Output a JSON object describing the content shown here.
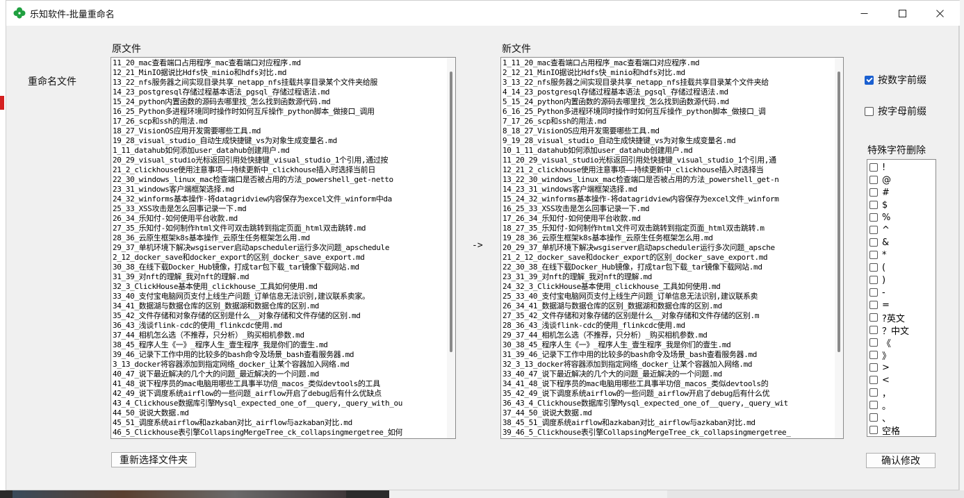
{
  "window": {
    "title": "乐知软件-批量重命名"
  },
  "rename_label": "重命名文件",
  "original": {
    "label": "原文件",
    "files": [
      "11_20_mac查看端口占用程序_mac查看端口对应程序.md",
      "12_21_MinIO据说比Hdfs快_minio和hdfs对比.md",
      "13_22_nfs服务器之间实现目录共享_netapp_nfs挂载共享目录某个文件夹给服",
      "14_23_postgresql存储过程基本语法_pgsql_存储过程语法.md",
      "15_24_python内置函数的源码去哪里找_怎么找到函数源代码.md",
      "16_25_Python多进程环境同时操作时如何互斥操作_python脚本_做接口_调用",
      "17_26_scp和ssh的用法.md",
      "18_27_VisionOS应用开发需要哪些工具.md",
      "19_28_visual_studio_自动生成快捷键_vs为对象生成变量名.md",
      "1_11_datahub如何添加user_datahub创建用户.md",
      "20_29_visual_studio光标返回引用处快捷键_visual_studio_1个引用,通过按",
      "21_2_clickhouse使用注意事项——持续更新中_clickhouse插入时选择当前日",
      "22_30_windows_linux_mac检查端口是否被占用的方法_powershell_get-netto",
      "23_31_windows客户端框架选择.md",
      "24_32_winforms基本操作-将datagridview内容保存为excel文件_winform中da",
      "25_33_XSS攻击是怎么回事记录一下.md",
      "26_34_乐知付-如何使用平台收款.md",
      "27_35_乐知付-如何制作html文件可双击跳转到指定页面_html双击跳转.md",
      "28_36_云原生框架k8s基本操作_云原生任务框架怎么用.md",
      "29_37_单机环境下解决wsgiserver启动apscheduler运行多次问题_apschedule",
      "2_12_docker_save和docker_export的区别_docker_save_export.md",
      "30_38_在线下载Docker_Hub镜像，打成tar包下载_tar镜像下载网站.md",
      "31_39_对nft的理解_我对nft的理解.md",
      "32_3_ClickHouse基本使用_clickhouse_工具如何使用.md",
      "33_40_支付宝电脑网页支付上线生产问题_订单信息无法识别,建议联系卖家。",
      "34_41_数据湖与数据仓库的区别_数据湖和数据仓库的区别.md",
      "35_42_文件存储和对象存储的区别是什么__对象存储和文件存储的区别.md",
      "36_43_浅谈flink-cdc的使用_flinkcdc使用.md",
      "37_44_相机怎么选（不推荐，只分析）_购买相机参数.md",
      "38_45_程序人生《一》_程序人生_壹生程序_我是你们的壹生.md",
      "39_46_记录下工作中用的比较多的bash命令及场景_bash查看服务器.md",
      "3_13_docker将容器添加到指定网络_docker_让某个容器加入网络.md",
      "40_47_说下最近解决的几个大的问题_最近解决的一个问题.md",
      "41_48_说下程序员的mac电脑用哪些工具事半功倍_macos_类似devtools的工具",
      "42_49_说下调度系统airflow的一些问题_airflow开启了debug后有什么优缺点",
      "43_4_Clickhouse数据库引擎Mysql_expected_one_of__query,_query_with_ou",
      "44_50_说说大数据.md",
      "45_51_调度系统airflow和azkaban对比_airflow与azkaban对比.md",
      "46_5_Clickhouse表引擎CollapsingMergeTree_ck_collapsingmergetree_如何"
    ]
  },
  "arrow": "->",
  "new": {
    "label": "新文件",
    "files": [
      "1_11_20_mac查看端口占用程序_mac查看端口对应程序.md",
      "2_12_21_MinIO据说比Hdfs快_minio和hdfs对比.md",
      "3_13_22_nfs服务器之间实现目录共享_netapp_nfs挂载共享目录某个文件夹给",
      "4_14_23_postgresql存储过程基本语法_pgsql_存储过程语法.md",
      "5_15_24_python内置函数的源码去哪里找_怎么找到函数源代码.md",
      "6_16_25_Python多进程环境同时操作时如何互斥操作_python脚本_做接口_调",
      "7_17_26_scp和ssh的用法.md",
      "8_18_27_VisionOS应用开发需要哪些工具.md",
      "9_19_28_visual_studio_自动生成快捷键_vs为对象生成变量名.md",
      "10_1_11_datahub如何添加user_datahub创建用户.md",
      "11_20_29_visual_studio光标返回引用处快捷键_visual_studio_1个引用,通",
      "12_21_2_clickhouse使用注意事项——持续更新中_clickhouse插入时选择当",
      "13_22_30_windows_linux_mac检查端口是否被占用的方法_powershell_get-n",
      "14_23_31_windows客户端框架选择.md",
      "15_24_32_winforms基本操作-将datagridview内容保存为excel文件_winform",
      "16_25_33_XSS攻击是怎么回事记录一下.md",
      "17_26_34_乐知付-如何使用平台收款.md",
      "18_27_35_乐知付-如何制作html文件可双击跳转到指定页面_html双击跳转.m",
      "19_28_36_云原生框架k8s基本操作_云原生任务框架怎么用.md",
      "20_29_37_单机环境下解决wsgiserver启动apscheduler运行多次问题_apsche",
      "21_2_12_docker_save和docker_export的区别_docker_save_export.md",
      "22_30_38_在线下载Docker_Hub镜像，打成tar包下载_tar镜像下载网站.md",
      "23_31_39_对nft的理解_我对nft的理解.md",
      "24_32_3_ClickHouse基本使用_clickhouse_工具如何使用.md",
      "25_33_40_支付宝电脑网页支付上线生产问题_订单信息无法识别,建议联系卖",
      "26_34_41_数据湖与数据仓库的区别_数据湖和数据仓库的区别.md",
      "27_35_42_文件存储和对象存储的区别是什么__对象存储和文件存储的区别.m",
      "28_36_43_浅谈flink-cdc的使用_flinkcdc使用.md",
      "29_37_44_相机怎么选（不推荐，只分析）_购买相机参数.md",
      "30_38_45_程序人生《一》_程序人生_壹生程序_我是你们的壹生.md",
      "31_39_46_记录下工作中用的比较多的bash命令及场景_bash查看服务器.md",
      "32_3_13_docker将容器添加到指定网络_docker_让某个容器加入网络.md",
      "33_40_47_说下最近解决的几个大的问题_最近解决的一个问题.md",
      "34_41_48_说下程序员的mac电脑用哪些工具事半功倍_macos_类似devtools的",
      "35_42_49_说下调度系统airflow的一些问题_airflow开启了debug后有什么优",
      "36_43_4_Clickhouse数据库引擎Mysql_expected_one_of__query,_query_wit",
      "37_44_50_说说大数据.md",
      "38_45_51_调度系统airflow和azkaban对比_airflow与azkaban对比.md",
      "39_46_5_Clickhouse表引擎CollapsingMergeTree_ck_collapsingmergetree_"
    ]
  },
  "options": {
    "numeric_prefix": {
      "label": "按数字前缀",
      "checked": true
    },
    "alpha_prefix": {
      "label": "按字母前缀",
      "checked": false
    }
  },
  "special_chars": {
    "label": "特殊字符删除",
    "items": [
      "!",
      "@",
      "#",
      "$",
      "%",
      "^",
      "&",
      "*",
      "(",
      ")",
      "-",
      "=",
      "?英文",
      "？中文",
      "《",
      "》",
      ">",
      "<",
      "，",
      "。",
      "、",
      "空格"
    ]
  },
  "buttons": {
    "reselect_folder": "重新选择文件夹",
    "confirm": "确认修改"
  },
  "icons": {
    "app": "green-clover-icon",
    "minimize": "minimize-icon",
    "maximize": "maximize-icon",
    "close": "close-icon"
  },
  "colors": {
    "checkbox_checked": "#1a5fd0",
    "app_icon": "#20a040"
  }
}
